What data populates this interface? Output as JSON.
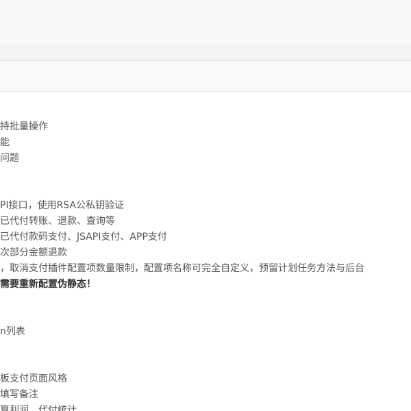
{
  "changelog": {
    "lines": [
      {
        "text": "持批量操作",
        "bold": false
      },
      {
        "text": "能",
        "bold": false
      },
      {
        "text": "问题",
        "bold": false
      },
      {
        "text": "PI接口，使用RSA公私钥验证",
        "bold": false
      },
      {
        "text": "已代付转账、退款、查询等",
        "bold": false
      },
      {
        "text": "已代付款码支付、JSAPI支付、APP支付",
        "bold": false
      },
      {
        "text": "次部分金额退款",
        "bold": false
      },
      {
        "text": "，取消支付插件配置项数量限制，配置项名称可完全自定义，预留计划任务方法与后台",
        "bold": false
      },
      {
        "text": "需要重新配置伪静态！",
        "bold": true
      },
      {
        "text": "n列表",
        "bold": false
      },
      {
        "text": "板支付页面风格",
        "bold": false
      },
      {
        "text": "填写备注",
        "bold": false
      },
      {
        "text": "算利润、代付统计",
        "bold": false
      }
    ]
  }
}
